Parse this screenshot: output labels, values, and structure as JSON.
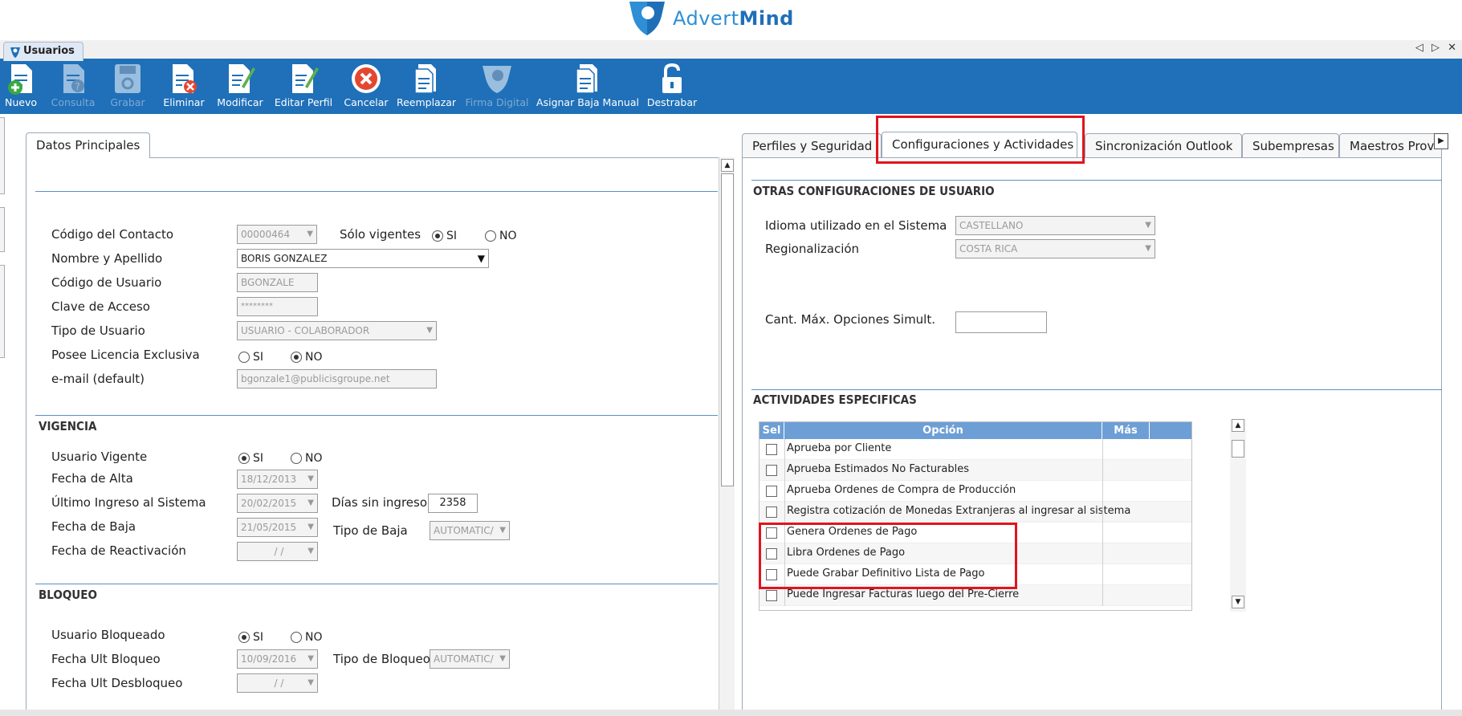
{
  "brand": {
    "name_light": "Advert",
    "name_bold": "Mind",
    "color": "#2e8fd6"
  },
  "window": {
    "tab_title": "Usuarios",
    "tab_arrows": "◁ ▷ ✕"
  },
  "toolbar": {
    "color": "#1f70b8",
    "buttons": [
      {
        "label": "Nuevo",
        "icon": "doc-add-icon",
        "enabled": true
      },
      {
        "label": "Consulta",
        "icon": "doc-query-icon",
        "enabled": false
      },
      {
        "label": "Grabar",
        "icon": "save-disk-icon",
        "enabled": false
      },
      {
        "label": "Eliminar",
        "icon": "doc-delete-icon",
        "enabled": true
      },
      {
        "label": "Modificar",
        "icon": "doc-edit-icon",
        "enabled": true
      },
      {
        "label": "Editar Perfil",
        "icon": "profile-edit-icon",
        "enabled": true
      },
      {
        "label": "Cancelar",
        "icon": "cancel-icon",
        "enabled": true
      },
      {
        "label": "Reemplazar",
        "icon": "doc-replace-icon",
        "enabled": true
      },
      {
        "label": "Firma Digital",
        "icon": "digital-sign-icon",
        "enabled": false
      },
      {
        "label": "Asignar Baja Manual",
        "icon": "doc-list-icon",
        "enabled": true
      },
      {
        "label": "Destrabar",
        "icon": "unlock-icon",
        "enabled": true
      }
    ]
  },
  "left_panel": {
    "tab": "Datos Principales",
    "main": {
      "codigo_contacto": {
        "label": "Código del Contacto",
        "value": "00000464"
      },
      "solo_vigentes": {
        "label": "Sólo vigentes",
        "si": "SI",
        "no": "NO",
        "selected": "SI"
      },
      "nombre": {
        "label": "Nombre y Apellido",
        "value": "BORIS GONZALEZ"
      },
      "codigo_usuario": {
        "label": "Código de Usuario",
        "value": "BGONZALE"
      },
      "clave": {
        "label": "Clave de Acceso",
        "value": "********"
      },
      "tipo_usuario": {
        "label": "Tipo de Usuario",
        "value": "USUARIO - COLABORADOR"
      },
      "licencia": {
        "label": "Posee Licencia Exclusiva",
        "si": "SI",
        "no": "NO",
        "selected": "NO"
      },
      "email": {
        "label": "e-mail (default)",
        "value": "bgonzale1@publicisgroupe.net"
      }
    },
    "vigencia": {
      "title": "VIGENCIA",
      "usuario_vigente": {
        "label": "Usuario Vigente",
        "si": "SI",
        "no": "NO",
        "selected": "SI"
      },
      "fecha_alta": {
        "label": "Fecha de Alta",
        "value": "18/12/2013"
      },
      "ultimo_ingreso": {
        "label": "Último Ingreso al Sistema",
        "value": "20/02/2015"
      },
      "dias_sin_ingreso": {
        "label": "Días sin ingreso",
        "value": "2358"
      },
      "fecha_baja": {
        "label": "Fecha de Baja",
        "value": "21/05/2015"
      },
      "tipo_baja": {
        "label": "Tipo de Baja",
        "value": "AUTOMATIC/"
      },
      "fecha_reactivacion": {
        "label": "Fecha de Reactivación",
        "value": " /  /"
      }
    },
    "bloqueo": {
      "title": "BLOQUEO",
      "usuario_bloqueado": {
        "label": "Usuario Bloqueado",
        "si": "SI",
        "no": "NO",
        "selected": "SI"
      },
      "fecha_ult_bloqueo": {
        "label": "Fecha Ult Bloqueo",
        "value": "10/09/2016"
      },
      "tipo_bloqueo": {
        "label": "Tipo de Bloqueo",
        "value": "AUTOMATIC/"
      },
      "fecha_ult_desbloqueo": {
        "label": "Fecha Ult Desbloqueo",
        "value": " /  /"
      }
    }
  },
  "right_panel": {
    "tabs": [
      {
        "label": "Perfiles y Seguridad"
      },
      {
        "label": "Configuraciones y Actividades"
      },
      {
        "label": "Sincronización Outlook"
      },
      {
        "label": "Subempresas"
      },
      {
        "label": "Maestros Prov"
      }
    ],
    "otras": {
      "title": "OTRAS CONFIGURACIONES DE USUARIO",
      "idioma": {
        "label": "Idioma utilizado en el Sistema",
        "value": "CASTELLANO"
      },
      "region": {
        "label": "Regionalización",
        "value": "COSTA RICA"
      },
      "cant_max": {
        "label": "Cant. Máx. Opciones Simult.",
        "value": ""
      }
    },
    "actividades": {
      "title": "ACTIVIDADES ESPECIFICAS",
      "columns": {
        "sel": "Sel",
        "opcion": "Opción",
        "mas": "Más"
      },
      "rows": [
        "Aprueba por Cliente",
        "Aprueba Estimados No Facturables",
        "Aprueba Ordenes de Compra de Producción",
        "Registra cotización de Monedas Extranjeras al ingresar al sistema",
        "Genera Ordenes de Pago",
        "Libra Ordenes de Pago",
        "Puede Grabar Definitivo Lista de Pago",
        "Puede Ingresar Facturas luego del Pre-Cierre"
      ]
    }
  }
}
